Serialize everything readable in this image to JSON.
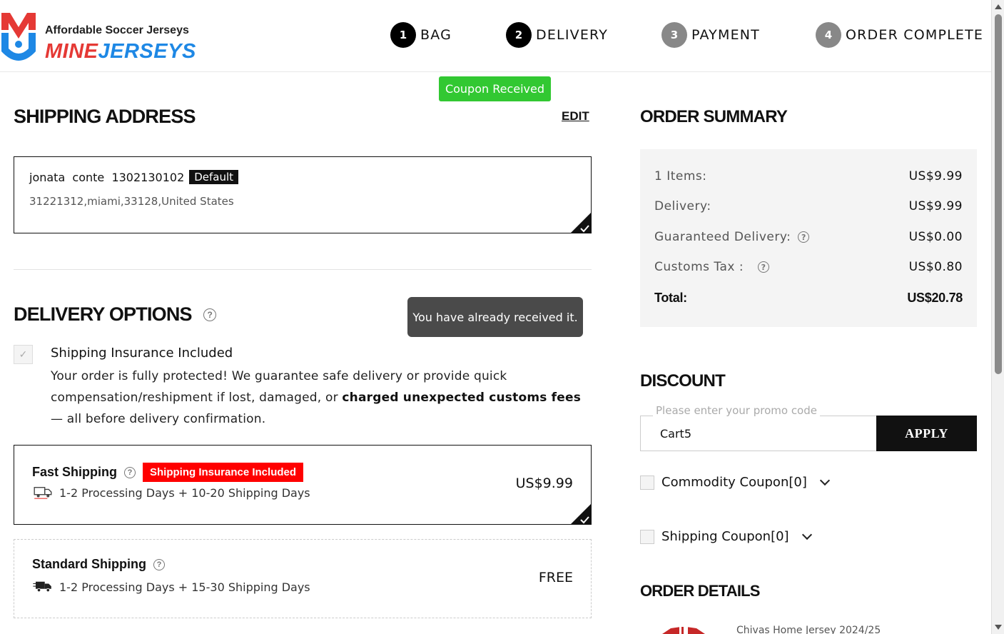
{
  "brand": {
    "tagline": "Affordable Soccer Jerseys",
    "name_part1": "MINE",
    "name_part2": "JERSEYS"
  },
  "steps": [
    {
      "num": "1",
      "label": "BAG",
      "state": "active"
    },
    {
      "num": "2",
      "label": "DELIVERY",
      "state": "active"
    },
    {
      "num": "3",
      "label": "PAYMENT",
      "state": "inactive"
    },
    {
      "num": "4",
      "label": "ORDER COMPLETE",
      "state": "inactive"
    }
  ],
  "toast": {
    "coupon_received": "Coupon Received"
  },
  "tooltip": {
    "text": "You have already received it."
  },
  "shipping_address": {
    "heading": "SHIPPING ADDRESS",
    "edit_label": "EDIT",
    "name": "jonata  conte  1302130102",
    "default_badge": "Default",
    "address_line": "31221312,miami,33128,United States"
  },
  "delivery_options": {
    "heading": "DELIVERY OPTIONS",
    "insurance": {
      "title": "Shipping Insurance Included",
      "desc_part1": "Your order is fully protected! We guarantee safe delivery or provide quick compensation/reshipment if lost, damaged, or ",
      "desc_bold": "charged unexpected customs fees",
      "desc_part2": " — all before delivery confirmation."
    },
    "options": [
      {
        "title": "Fast Shipping",
        "badge": "Shipping Insurance Included",
        "days": "1-2 Processing Days + 10-20 Shipping Days",
        "price": "US$9.99",
        "selected": true
      },
      {
        "title": "Standard Shipping",
        "days": "1-2 Processing Days + 15-30 Shipping Days",
        "price": "FREE",
        "selected": false
      }
    ]
  },
  "order_summary": {
    "heading": "ORDER SUMMARY",
    "rows": [
      {
        "label": "1 Items:",
        "value": "US$9.99"
      },
      {
        "label": "Delivery:",
        "value": "US$9.99"
      },
      {
        "label": "Guaranteed Delivery:",
        "value": "US$0.00"
      },
      {
        "label": "Customs Tax :",
        "value": "US$0.80"
      }
    ],
    "total_label": "Total:",
    "total_value": "US$20.78"
  },
  "discount": {
    "heading": "DISCOUNT",
    "promo_placeholder": "Please enter your promo code",
    "promo_value": "Cart5",
    "apply_label": "APPLY",
    "commodity_coupon": "Commodity Coupon[0]",
    "shipping_coupon": "Shipping Coupon[0]"
  },
  "order_details": {
    "heading": "ORDER DETAILS",
    "product_name": "Chivas Home Jersey 2024/25"
  },
  "colors": {
    "coupon_toast": "#32c832",
    "badge_red": "#ff0000",
    "brand_red": "#e53935",
    "brand_blue": "#1e88e5"
  }
}
